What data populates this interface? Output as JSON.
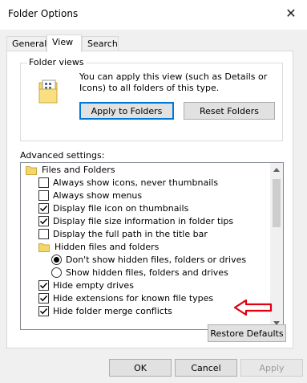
{
  "window": {
    "title": "Folder Options",
    "close_glyph": "✕"
  },
  "tabs": [
    {
      "label": "General",
      "active": false
    },
    {
      "label": "View",
      "active": true
    },
    {
      "label": "Search",
      "active": false
    }
  ],
  "folder_views": {
    "legend": "Folder views",
    "description": "You can apply this view (such as Details or Icons) to all folders of this type.",
    "apply_button": "Apply to Folders",
    "reset_button": "Reset Folders"
  },
  "advanced": {
    "label": "Advanced settings:",
    "items": [
      {
        "type": "folder",
        "label": "Files and Folders"
      },
      {
        "type": "checkbox",
        "label": "Always show icons, never thumbnails",
        "checked": false
      },
      {
        "type": "checkbox",
        "label": "Always show menus",
        "checked": false
      },
      {
        "type": "checkbox",
        "label": "Display file icon on thumbnails",
        "checked": true
      },
      {
        "type": "checkbox",
        "label": "Display file size information in folder tips",
        "checked": true
      },
      {
        "type": "checkbox",
        "label": "Display the full path in the title bar",
        "checked": false
      },
      {
        "type": "folder",
        "label": "Hidden files and folders"
      },
      {
        "type": "radio",
        "label": "Don't show hidden files, folders or drives",
        "checked": true
      },
      {
        "type": "radio",
        "label": "Show hidden files, folders and drives",
        "checked": false
      },
      {
        "type": "checkbox",
        "label": "Hide empty drives",
        "checked": true
      },
      {
        "type": "checkbox",
        "label": "Hide extensions for known file types",
        "checked": true
      },
      {
        "type": "checkbox",
        "label": "Hide folder merge conflicts",
        "checked": true
      }
    ]
  },
  "restore_defaults": "Restore Defaults",
  "footer": {
    "ok": "OK",
    "cancel": "Cancel",
    "apply": "Apply"
  },
  "colors": {
    "accent": "#0078d7",
    "annotation": "#e0000f",
    "folder": "#f5d66b"
  }
}
